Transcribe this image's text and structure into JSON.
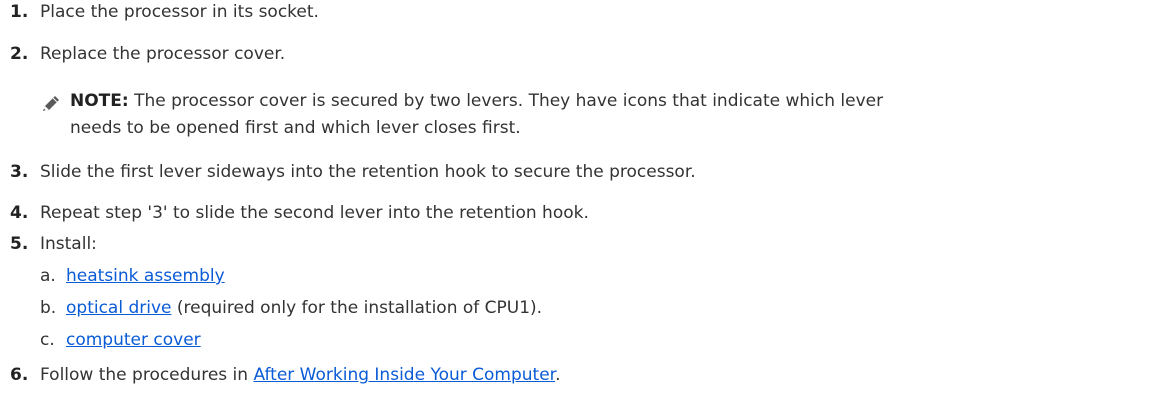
{
  "steps": [
    {
      "number": "1.",
      "text": "Place the processor in its socket."
    },
    {
      "number": "2.",
      "text": "Replace the processor cover."
    },
    {
      "number": "3.",
      "text": "Slide the first lever sideways into the retention hook to secure the processor."
    },
    {
      "number": "4.",
      "text": "Repeat step '3' to slide the second lever into the retention hook."
    },
    {
      "number": "5.",
      "text": "Install:"
    },
    {
      "number": "6.",
      "text_before": "Follow the procedures in ",
      "link": "After Working Inside Your Computer",
      "text_after": "."
    }
  ],
  "note": {
    "icon": "pencil-icon",
    "label": "NOTE:",
    "line1": " The processor cover is secured by two levers. They have icons that indicate which lever",
    "line2": "needs to be opened first and which lever closes first."
  },
  "install_items": [
    {
      "letter": "a.",
      "link": "heatsink assembly",
      "suffix": ""
    },
    {
      "letter": "b.",
      "link": "optical drive",
      "suffix": " (required only for the installation of CPU1)."
    },
    {
      "letter": "c.",
      "link": "computer cover",
      "suffix": ""
    }
  ],
  "colors": {
    "text": "#333333",
    "link": "#0a5bd6"
  }
}
